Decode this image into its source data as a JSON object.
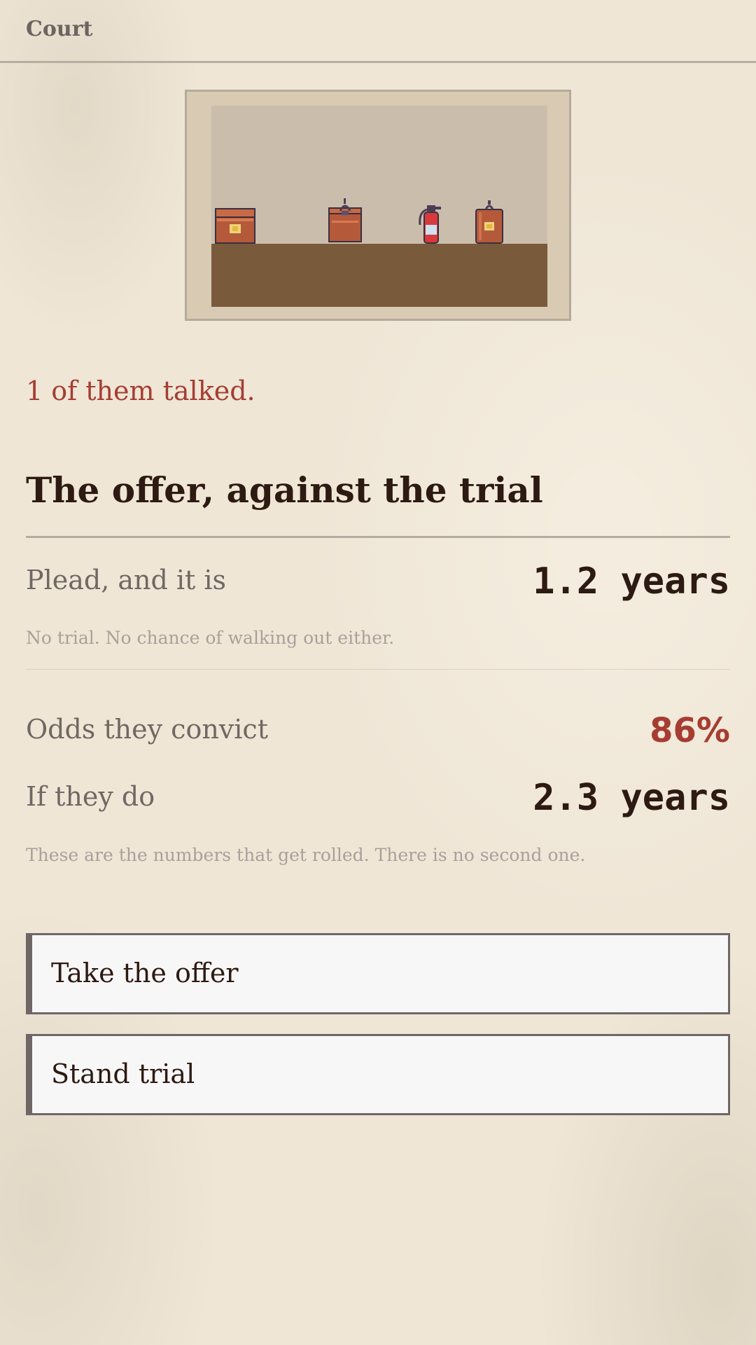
{
  "header": {
    "title": "Court"
  },
  "scene": {
    "items": [
      "chest",
      "locked-case",
      "fire-extinguisher",
      "lantern"
    ]
  },
  "outcome": {
    "talked": "1 of them talked."
  },
  "offer": {
    "title": "The offer, against the trial",
    "plead_label": "Plead, and it is",
    "plead_value": "1.2 years",
    "plead_note": "No trial. No chance of walking out either.",
    "odds_label": "Odds they convict",
    "odds_value": "86%",
    "sentence_label": "If they do",
    "sentence_value": "2.3 years",
    "numbers_note": "These are the numbers that get rolled. There is no second one."
  },
  "choices": {
    "take_offer": "Take the offer",
    "stand_trial": "Stand trial"
  },
  "colors": {
    "accent_red": "#a63d32",
    "ink": "#2d1a12",
    "paper": "#efe6d6"
  }
}
